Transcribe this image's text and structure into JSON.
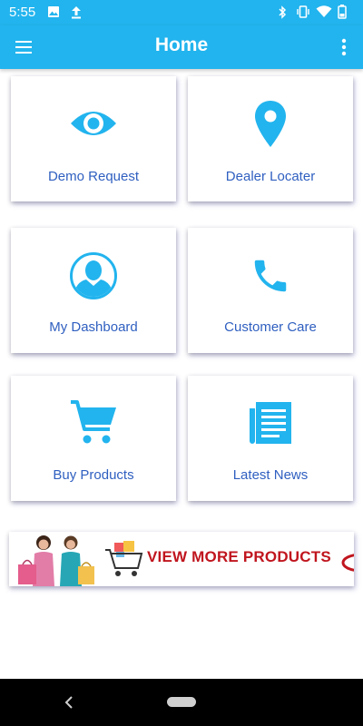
{
  "status_bar": {
    "time": "5:55",
    "icons": [
      "image-icon",
      "upload-icon",
      "bluetooth-icon",
      "vibrate-icon",
      "wifi-icon",
      "battery-icon"
    ]
  },
  "app_bar": {
    "title": "Home",
    "menu_icon": "hamburger-menu-icon",
    "overflow_icon": "more-vert-icon"
  },
  "tiles": [
    {
      "label": "Demo Request",
      "icon": "eye-icon"
    },
    {
      "label": "Dealer Locater",
      "icon": "location-pin-icon"
    },
    {
      "label": "My Dashboard",
      "icon": "user-profile-icon"
    },
    {
      "label": "Customer Care",
      "icon": "phone-icon"
    },
    {
      "label": "Buy Products",
      "icon": "shopping-cart-icon"
    },
    {
      "label": "Latest News",
      "icon": "newspaper-icon"
    }
  ],
  "banner": {
    "text": "VIEW MORE PRODUCTS"
  },
  "colors": {
    "primary": "#22b4ee",
    "label_text": "#2f5fc0",
    "banner_text": "#c0151e"
  }
}
